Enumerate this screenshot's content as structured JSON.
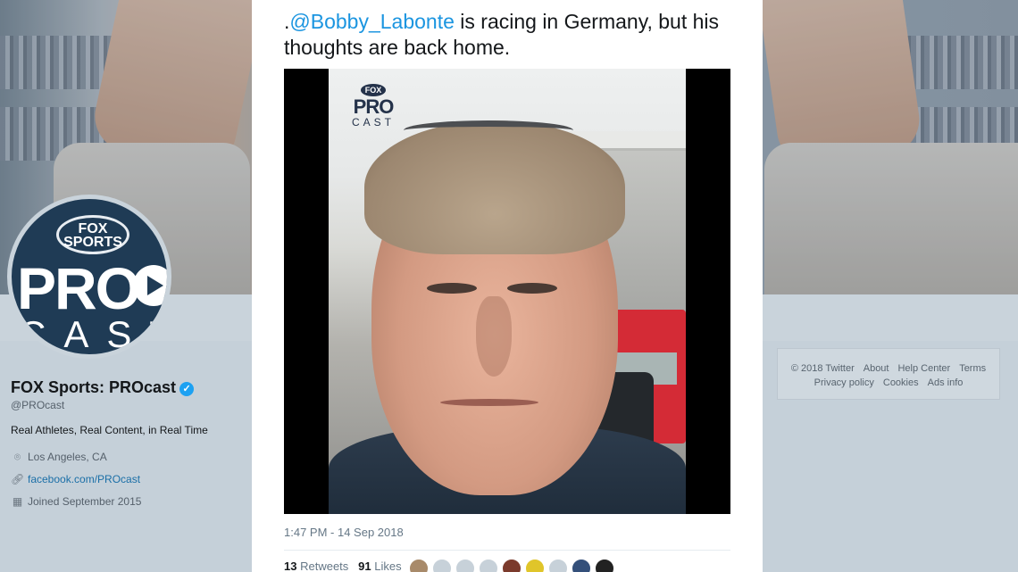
{
  "profile": {
    "logo_text": "FOX SPORTS",
    "logo_pro": "PRO",
    "logo_cast": "CAST",
    "name": "FOX Sports: PROcast",
    "handle": "@PROcast",
    "bio": "Real Athletes, Real Content, in Real Time",
    "location": "Los Angeles, CA",
    "website": "facebook.com/PROcast",
    "joined": "Joined September 2015",
    "icons": [
      "location-pin-icon",
      "link-icon",
      "calendar-icon"
    ]
  },
  "footer": {
    "links": [
      "© 2018 Twitter",
      "About",
      "Help Center",
      "Terms",
      "Privacy policy",
      "Cookies",
      "Ads info"
    ]
  },
  "tweet": {
    "text_prefix": ".",
    "mention": "@Bobby_Labonte",
    "text_rest": " is racing in Germany, but his thoughts are back home.",
    "video_logo": {
      "fox": "FOX",
      "pro": "PRO",
      "cast": "CAST"
    },
    "timestamp": "1:47 PM - 14 Sep 2018",
    "retweets_count": "13",
    "retweets_label": "Retweets",
    "likes_count": "91",
    "likes_label": "Likes"
  },
  "colors": {
    "mention": "#1b95e0",
    "verified": "#1da1f2",
    "brand_navy": "#1f3b55"
  }
}
